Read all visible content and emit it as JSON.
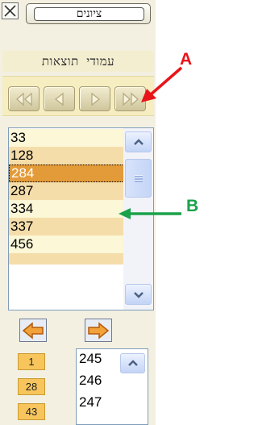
{
  "header": {
    "tzionim_label": "ציונים"
  },
  "pages_title": "עמודי תוצאות",
  "nav": {
    "buttons": [
      "first",
      "prev",
      "next",
      "last"
    ]
  },
  "results": {
    "rows": [
      "33",
      "128",
      "284",
      "287",
      "334",
      "337",
      "456"
    ],
    "selected_index": 2
  },
  "pages_column": [
    "1",
    "28",
    "43"
  ],
  "mini_list": [
    "245",
    "246",
    "247"
  ],
  "annotations": {
    "a_label": "A",
    "b_label": "B",
    "a_color": "#e8141a",
    "b_color": "#1aa24a"
  },
  "colors": {
    "odd_row": "#fbf7d7",
    "even_row": "#f5ddaa",
    "selected_row": "#e39a38",
    "page_chip": "#f7c55c"
  },
  "icons": {
    "close": "close-icon",
    "first": "double-left-arrow-icon",
    "prev": "left-arrow-icon",
    "next": "right-arrow-icon",
    "last": "double-right-arrow-icon",
    "scroll_up": "chevron-up-icon",
    "scroll_down": "chevron-down-icon",
    "back_arrow": "orange-left-arrow-icon",
    "forward_arrow": "orange-right-arrow-icon"
  }
}
